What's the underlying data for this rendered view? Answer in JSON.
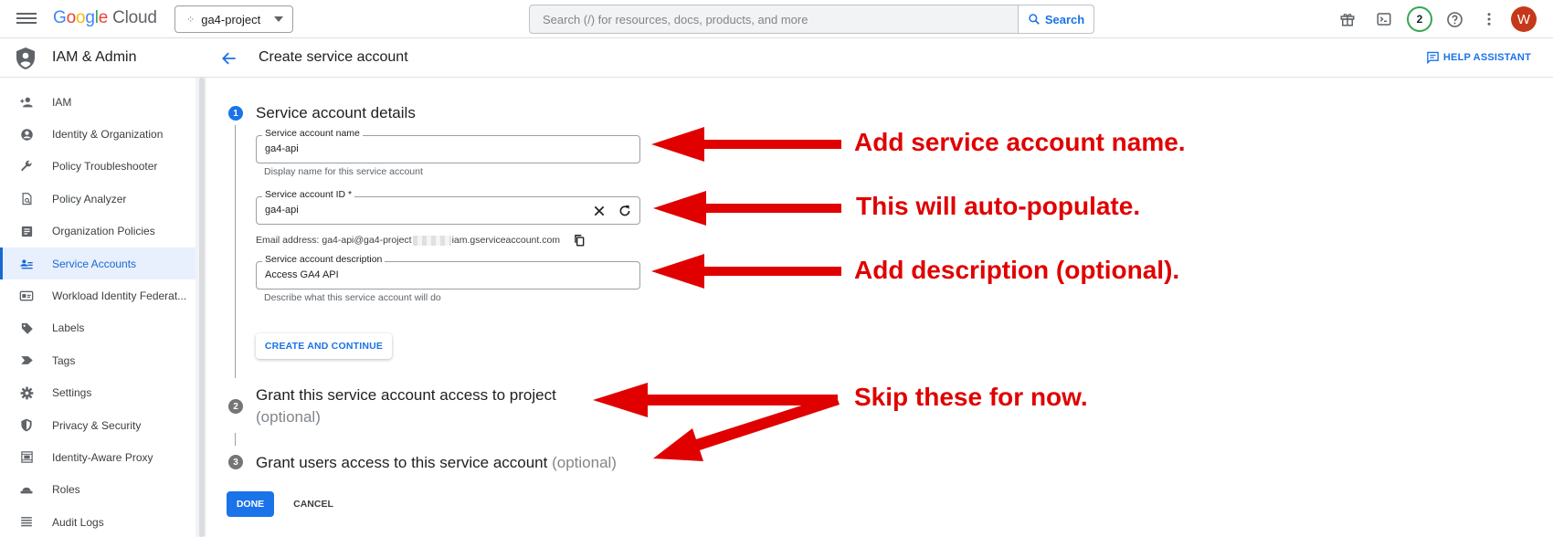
{
  "topbar": {
    "brand_letters": [
      "G",
      "o",
      "o",
      "g",
      "l",
      "e"
    ],
    "brand_product": "Cloud",
    "project": "ga4-project",
    "search_placeholder": "Search (/) for resources, docs, products, and more",
    "search_button": "Search",
    "notification_count": "2",
    "avatar_initial": "W"
  },
  "sidebar": {
    "product_title": "IAM & Admin",
    "items": [
      {
        "label": "IAM",
        "icon": "person-add-icon"
      },
      {
        "label": "Identity & Organization",
        "icon": "account-circle-icon"
      },
      {
        "label": "Policy Troubleshooter",
        "icon": "wrench-icon"
      },
      {
        "label": "Policy Analyzer",
        "icon": "document-search-icon"
      },
      {
        "label": "Organization Policies",
        "icon": "list-document-icon"
      },
      {
        "label": "Service Accounts",
        "icon": "service-account-icon",
        "active": true
      },
      {
        "label": "Workload Identity Federat...",
        "icon": "id-card-icon"
      },
      {
        "label": "Labels",
        "icon": "label-tag-icon"
      },
      {
        "label": "Tags",
        "icon": "tag-arrow-icon"
      },
      {
        "label": "Settings",
        "icon": "gear-icon"
      },
      {
        "label": "Privacy & Security",
        "icon": "shield-icon"
      },
      {
        "label": "Identity-Aware Proxy",
        "icon": "proxy-icon"
      },
      {
        "label": "Roles",
        "icon": "roles-hat-icon"
      },
      {
        "label": "Audit Logs",
        "icon": "list-lines-icon"
      }
    ]
  },
  "header": {
    "title": "Create service account",
    "help_assistant": "HELP ASSISTANT"
  },
  "steps": {
    "step1": {
      "number": "1",
      "title": "Service account details"
    },
    "step2": {
      "number": "2",
      "title": "Grant this service account access to project",
      "optional": "(optional)"
    },
    "step3": {
      "number": "3",
      "title": "Grant users access to this service account",
      "optional": "(optional)"
    }
  },
  "form": {
    "name_label": "Service account name",
    "name_value": "ga4-api",
    "name_hint": "Display name for this service account",
    "id_label": "Service account ID *",
    "id_value": "ga4-api",
    "email_prefix": "Email address: ga4-api@ga4-project",
    "email_suffix": "iam.gserviceaccount.com",
    "description_label": "Service account description",
    "description_value": "Access GA4 API",
    "description_hint": "Describe what this service account will do",
    "create_button": "CREATE AND CONTINUE"
  },
  "actions": {
    "done": "DONE",
    "cancel": "CANCEL"
  },
  "annotations": {
    "name": "Add service account name.",
    "id": "This will auto-populate.",
    "description": "Add description (optional).",
    "skip": "Skip these for now.",
    "color": "#e00000"
  }
}
